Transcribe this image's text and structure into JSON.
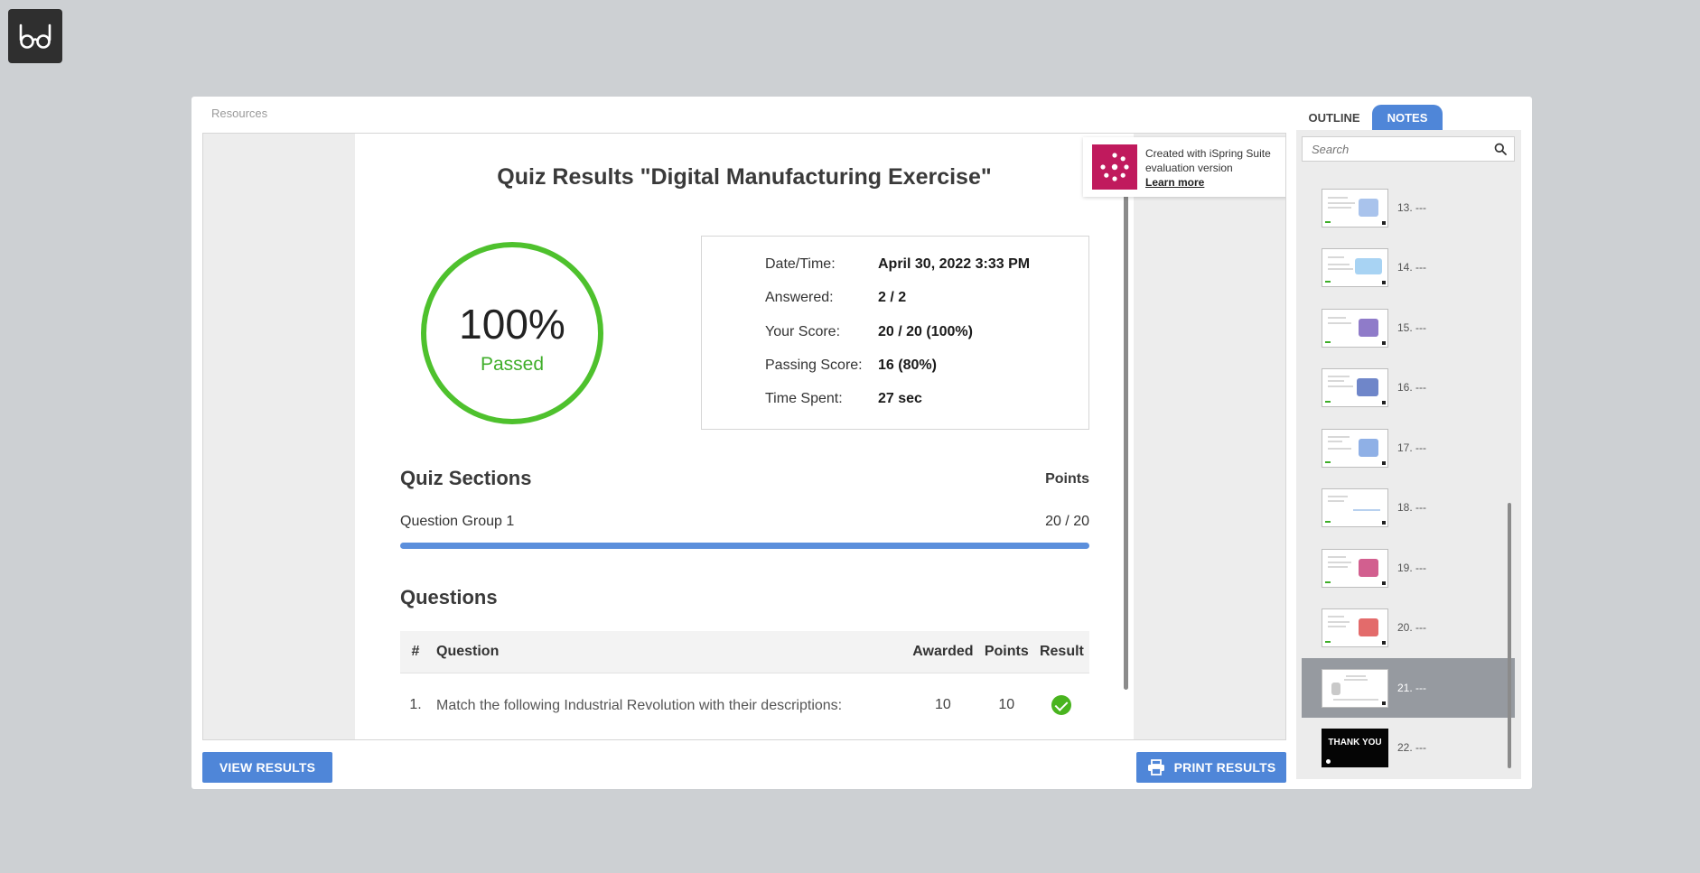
{
  "player": {
    "resources_label": "Resources"
  },
  "quiz": {
    "title": "Quiz Results \"Digital Manufacturing Exercise\"",
    "score_percent": "100%",
    "status": "Passed",
    "score_ring_fill": 1.0,
    "stats": [
      {
        "label": "Date/Time:",
        "value": "April 30, 2022 3:33 PM"
      },
      {
        "label": "Answered:",
        "value": "2 / 2"
      },
      {
        "label": "Your Score:",
        "value": "20 / 20 (100%)"
      },
      {
        "label": "Passing Score:",
        "value": "16 (80%)"
      },
      {
        "label": "Time Spent:",
        "value": "27 sec"
      }
    ],
    "sections_title": "Quiz Sections",
    "points_header": "Points",
    "groups": [
      {
        "label": "Question Group 1",
        "score": "20 / 20",
        "progress": 1.0
      }
    ],
    "questions_title": "Questions",
    "table_headers": {
      "num": "#",
      "question": "Question",
      "awarded": "Awarded",
      "points": "Points",
      "result": "Result"
    },
    "rows": [
      {
        "num": "1.",
        "question": "Match the following Industrial Revolution with their descriptions:",
        "awarded": "10",
        "points": "10",
        "result": "correct"
      }
    ]
  },
  "ispring": {
    "text": "Created with iSpring Suite evaluation version",
    "link": "Learn more",
    "color": "#c01a5d"
  },
  "buttons": {
    "view_results": "VIEW RESULTS",
    "print_results": "PRINT RESULTS"
  },
  "sidebar": {
    "tabs": {
      "outline": "OUTLINE",
      "notes": "NOTES"
    },
    "active_tab": "notes",
    "search_placeholder": "Search",
    "slides": [
      {
        "label": "13. ---"
      },
      {
        "label": "14. ---"
      },
      {
        "label": "15. ---"
      },
      {
        "label": "16. ---"
      },
      {
        "label": "17. ---"
      },
      {
        "label": "18. ---"
      },
      {
        "label": "19. ---"
      },
      {
        "label": "20. ---"
      },
      {
        "label": "21. ---",
        "active": true
      },
      {
        "label": "22. ---",
        "thumb_text": "THANK YOU"
      }
    ]
  },
  "colors": {
    "accent": "#4f86d8",
    "pass_green": "#4ec12d",
    "background": "#cdd0d3"
  }
}
